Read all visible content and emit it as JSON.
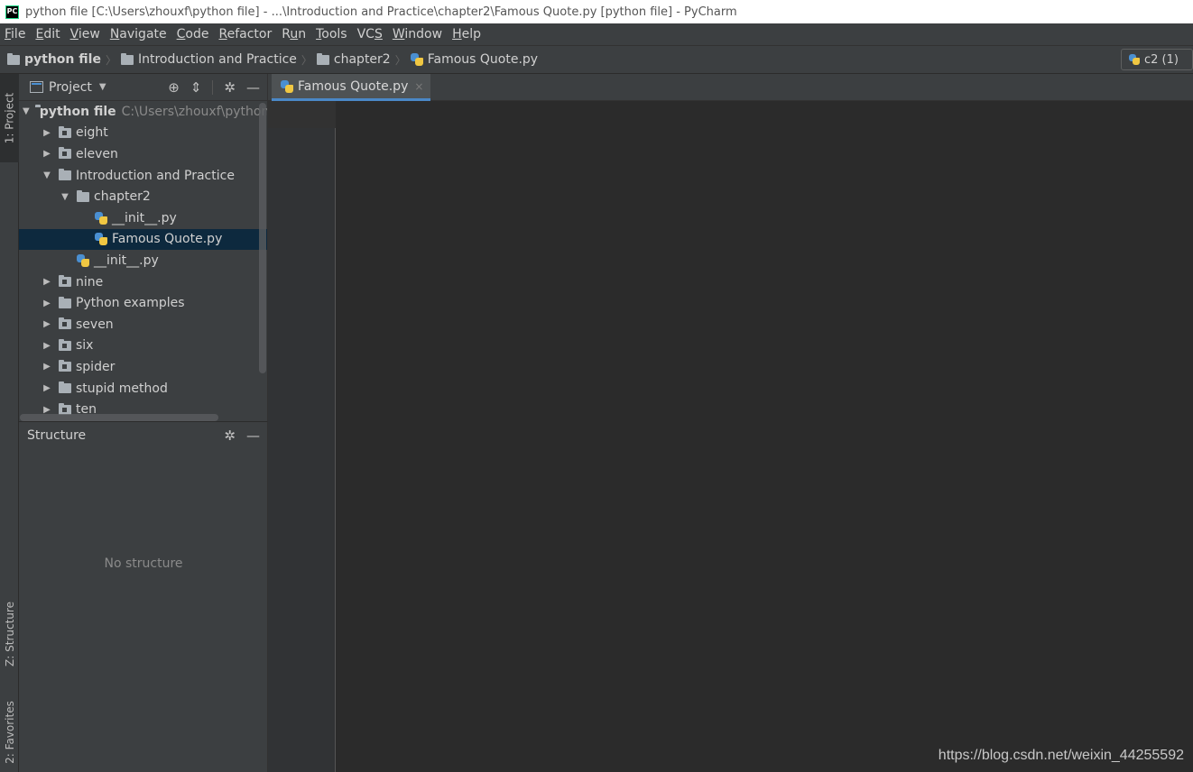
{
  "window": {
    "title": "python file [C:\\Users\\zhouxf\\python file] - ...\\Introduction and Practice\\chapter2\\Famous Quote.py [python file] - PyCharm"
  },
  "menu": [
    {
      "u": "F",
      "rest": "ile"
    },
    {
      "u": "E",
      "rest": "dit"
    },
    {
      "u": "V",
      "rest": "iew"
    },
    {
      "u": "N",
      "rest": "avigate"
    },
    {
      "u": "C",
      "rest": "ode"
    },
    {
      "u": "R",
      "rest": "efactor"
    },
    {
      "pre": "R",
      "u": "u",
      "rest": "n"
    },
    {
      "u": "T",
      "rest": "ools"
    },
    {
      "pre": "VC",
      "u": "S",
      "rest": ""
    },
    {
      "u": "W",
      "rest": "indow"
    },
    {
      "u": "H",
      "rest": "elp"
    }
  ],
  "breadcrumb": {
    "root": "python file",
    "folder1": "Introduction and Practice",
    "folder2": "chapter2",
    "file": "Famous Quote.py"
  },
  "run_config": "c2 (1)",
  "stripe": {
    "project": "1: Project",
    "structure": "Z: Structure",
    "favorites": "2: Favorites"
  },
  "project_panel": {
    "title": "Project",
    "tree": [
      {
        "label": "python file",
        "path": "C:\\Users\\zhouxf\\python",
        "depth": 0,
        "toggle": "open",
        "icon": "folder",
        "bold": true
      },
      {
        "label": "eight",
        "depth": 1,
        "toggle": "closed",
        "icon": "package"
      },
      {
        "label": "eleven",
        "depth": 1,
        "toggle": "closed",
        "icon": "package"
      },
      {
        "label": "Introduction and Practice",
        "depth": 1,
        "toggle": "open",
        "icon": "folder"
      },
      {
        "label": "chapter2",
        "depth": 2,
        "toggle": "open",
        "icon": "folder"
      },
      {
        "label": "__init__.py",
        "depth": 3,
        "toggle": "none",
        "icon": "python"
      },
      {
        "label": "Famous Quote.py",
        "depth": 3,
        "toggle": "none",
        "icon": "python",
        "selected": true
      },
      {
        "label": "__init__.py",
        "depth": 2,
        "toggle": "none",
        "icon": "python"
      },
      {
        "label": "nine",
        "depth": 1,
        "toggle": "closed",
        "icon": "package"
      },
      {
        "label": "Python examples",
        "depth": 1,
        "toggle": "closed",
        "icon": "folder"
      },
      {
        "label": "seven",
        "depth": 1,
        "toggle": "closed",
        "icon": "package"
      },
      {
        "label": "six",
        "depth": 1,
        "toggle": "closed",
        "icon": "package"
      },
      {
        "label": "spider",
        "depth": 1,
        "toggle": "closed",
        "icon": "package"
      },
      {
        "label": "stupid method",
        "depth": 1,
        "toggle": "closed",
        "icon": "folder"
      },
      {
        "label": "ten",
        "depth": 1,
        "toggle": "closed",
        "icon": "package"
      }
    ]
  },
  "structure_panel": {
    "title": "Structure",
    "empty_text": "No structure"
  },
  "editor": {
    "tab_label": "Famous Quote.py"
  },
  "watermark": "https://blog.csdn.net/weixin_44255592"
}
